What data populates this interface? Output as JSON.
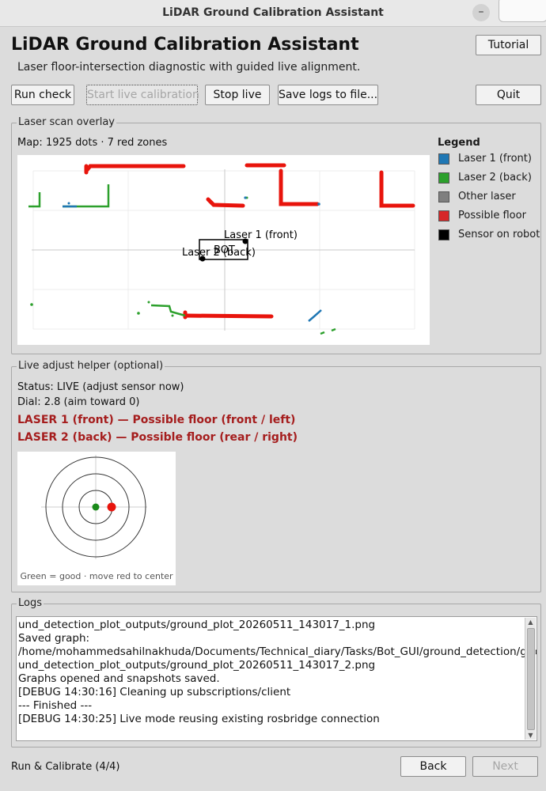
{
  "window": {
    "title": "LiDAR Ground Calibration Assistant",
    "minimize_glyph": "–"
  },
  "header": {
    "title": "LiDAR Ground Calibration Assistant",
    "subtitle": "Laser floor-intersection diagnostic with guided live alignment.",
    "tutorial_label": "Tutorial"
  },
  "toolbar": {
    "run_check": "Run check",
    "start_live": "Start live calibration",
    "stop_live": "Stop live",
    "save_logs": "Save logs to file...",
    "quit": "Quit"
  },
  "scan": {
    "group_title": "Laser scan overlay",
    "map_info": "Map: 1925 dots · 7 red zones",
    "robot_label": "BOT",
    "laser1_label": "Laser 1 (front)",
    "laser2_label": "Laser 2 (back)",
    "legend": {
      "title": "Legend",
      "items": [
        {
          "label": "Laser 1 (front)",
          "color": "#1f77b4"
        },
        {
          "label": "Laser 2 (back)",
          "color": "#2ca02c"
        },
        {
          "label": "Other laser",
          "color": "#7f7f7f"
        },
        {
          "label": "Possible floor",
          "color": "#d62728"
        },
        {
          "label": "Sensor on robot",
          "color": "#000000"
        }
      ]
    }
  },
  "live": {
    "group_title": "Live adjust helper (optional)",
    "status": "Status: LIVE (adjust sensor now)",
    "dial": "Dial: 2.8 (aim toward 0)",
    "warning1": "LASER 1 (front) — Possible floor (front / left)",
    "warning2": "LASER 2 (back) — Possible floor (rear / right)",
    "target_caption": "Green = good · move red to center",
    "good_color": "#1a8a1a",
    "current_color": "#e8140c"
  },
  "logs": {
    "group_title": "Logs",
    "lines": [
      "und_detection_plot_outputs/ground_plot_20260511_143017_1.png",
      "Saved graph:",
      "/home/mohammedsahilnakhuda/Documents/Technical_diary/Tasks/Bot_GUI/ground_detection/gro",
      "und_detection_plot_outputs/ground_plot_20260511_143017_2.png",
      "Graphs opened and snapshots saved.",
      "[DEBUG 14:30:16] Cleaning up subscriptions/client",
      "--- Finished ---",
      "[DEBUG 14:30:25] Live mode reusing existing rosbridge connection"
    ]
  },
  "footer": {
    "step": "Run & Calibrate (4/4)",
    "back": "Back",
    "next": "Next"
  }
}
